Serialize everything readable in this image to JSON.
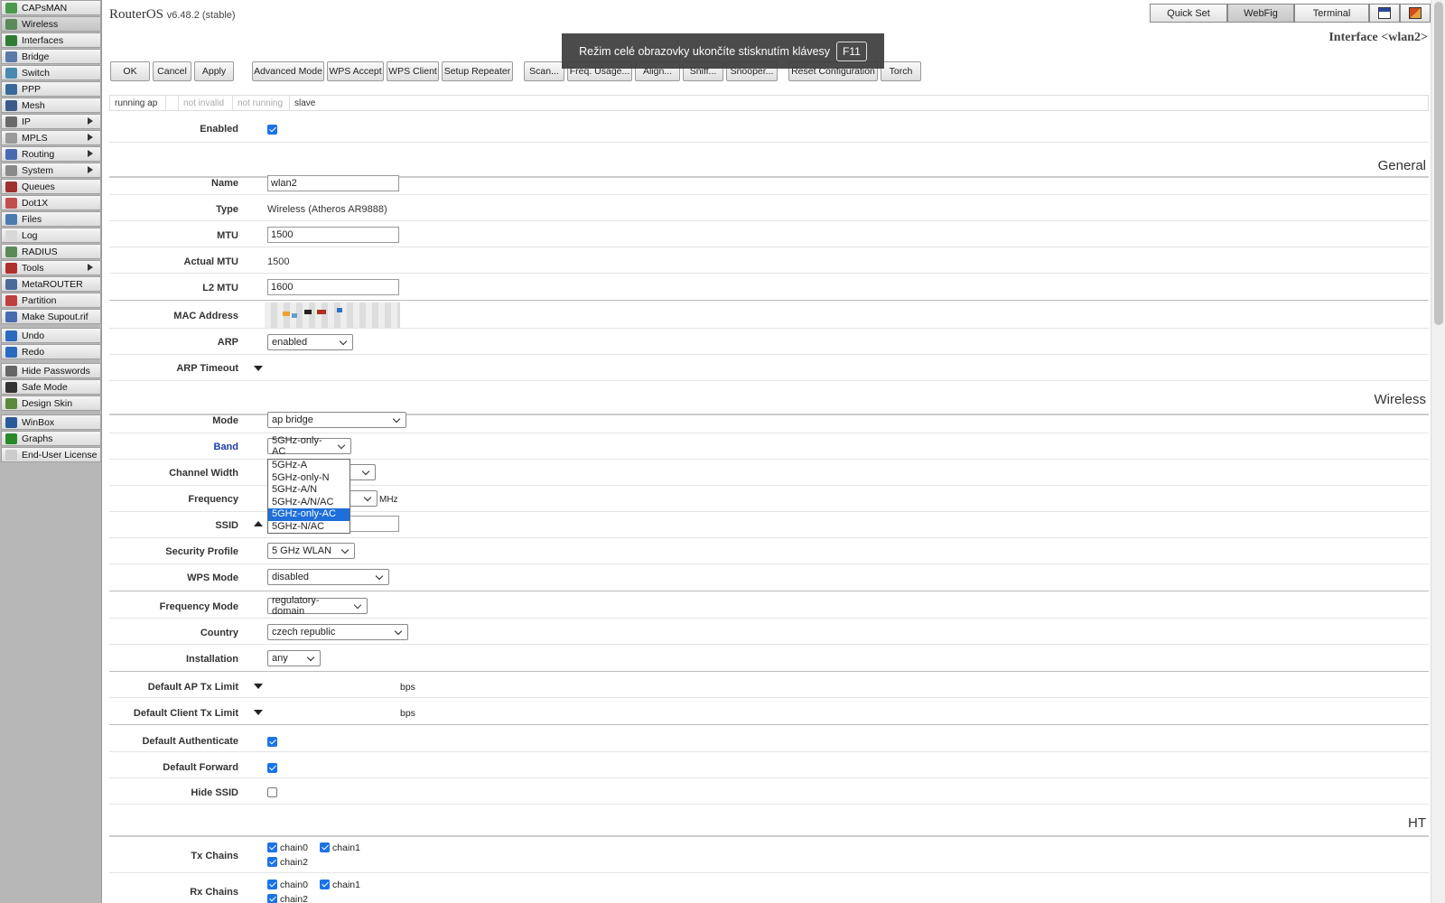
{
  "sidebar": {
    "items": [
      {
        "label": "CAPsMAN",
        "icon": "capsman-icon",
        "color": "#4a9a4a",
        "arrow": false
      },
      {
        "label": "Wireless",
        "icon": "wireless-icon",
        "color": "#5a8a5a",
        "arrow": false,
        "selected": true
      },
      {
        "label": "Interfaces",
        "icon": "interfaces-icon",
        "color": "#2e7d32",
        "arrow": false
      },
      {
        "label": "Bridge",
        "icon": "bridge-icon",
        "color": "#5a7aa8",
        "arrow": false
      },
      {
        "label": "Switch",
        "icon": "switch-icon",
        "color": "#4a8ab0",
        "arrow": false
      },
      {
        "label": "PPP",
        "icon": "ppp-icon",
        "color": "#3a6a9a",
        "arrow": false
      },
      {
        "label": "Mesh",
        "icon": "mesh-icon",
        "color": "#3a5a8a",
        "arrow": false
      },
      {
        "label": "IP",
        "icon": "ip-icon",
        "color": "#6a6a6a",
        "arrow": true
      },
      {
        "label": "MPLS",
        "icon": "mpls-icon",
        "color": "#9a9a9a",
        "arrow": true
      },
      {
        "label": "Routing",
        "icon": "routing-icon",
        "color": "#4a6ab0",
        "arrow": true
      },
      {
        "label": "System",
        "icon": "system-icon",
        "color": "#8a8a8a",
        "arrow": true
      },
      {
        "label": "Queues",
        "icon": "queues-icon",
        "color": "#a03030",
        "arrow": false
      },
      {
        "label": "Dot1X",
        "icon": "dot1x-icon",
        "color": "#c05050",
        "arrow": false
      },
      {
        "label": "Files",
        "icon": "files-icon",
        "color": "#4a7ab0",
        "arrow": false
      },
      {
        "label": "Log",
        "icon": "log-icon",
        "color": "#d8d8d8",
        "arrow": false
      },
      {
        "label": "RADIUS",
        "icon": "radius-icon",
        "color": "#5a8a5a",
        "arrow": false
      },
      {
        "label": "Tools",
        "icon": "tools-icon",
        "color": "#b03030",
        "arrow": true
      },
      {
        "label": "MetaROUTER",
        "icon": "metarouter-icon",
        "color": "#4a6a9a",
        "arrow": false
      },
      {
        "label": "Partition",
        "icon": "partition-icon",
        "color": "#c04040",
        "arrow": false
      },
      {
        "label": "Make Supout.rif",
        "icon": "supout-icon",
        "color": "#4a6ab0",
        "arrow": false
      }
    ],
    "group2": [
      {
        "label": "Undo",
        "icon": "undo-icon",
        "color": "#2a6ac0"
      },
      {
        "label": "Redo",
        "icon": "redo-icon",
        "color": "#2a6ac0"
      }
    ],
    "group3": [
      {
        "label": "Hide Passwords",
        "icon": "hide-passwords-icon",
        "color": "#666666"
      },
      {
        "label": "Safe Mode",
        "icon": "safe-mode-icon",
        "color": "#333333"
      },
      {
        "label": "Design Skin",
        "icon": "design-skin-icon",
        "color": "#5a8a3a"
      }
    ],
    "group4": [
      {
        "label": "WinBox",
        "icon": "winbox-icon",
        "color": "#2a5a9a"
      },
      {
        "label": "Graphs",
        "icon": "graphs-icon",
        "color": "#2a8a2a"
      },
      {
        "label": "End-User License",
        "icon": "license-icon",
        "color": "#cccccc"
      }
    ]
  },
  "header": {
    "product": "RouterOS",
    "version": "v6.48.2 (stable)",
    "tabs": [
      "Quick Set",
      "WebFig",
      "Terminal"
    ],
    "active_tab": "WebFig",
    "interface_title": "Interface <wlan2>"
  },
  "toast": {
    "text": "Režim celé obrazovky ukončíte stisknutím klávesy",
    "key": "F11"
  },
  "toolbar": {
    "buttons": [
      "OK",
      "Cancel",
      "Apply",
      "Advanced Mode",
      "WPS Accept",
      "WPS Client",
      "Setup Repeater",
      "Scan...",
      "Freq. Usage...",
      "Align...",
      "Sniff...",
      "Snooper...",
      "Reset Configuration",
      "Torch"
    ]
  },
  "status": [
    "running ap",
    "",
    "not invalid",
    "not running",
    "slave"
  ],
  "form": {
    "enabled_label": "Enabled",
    "general_header": "General",
    "name_label": "Name",
    "name_value": "wlan2",
    "type_label": "Type",
    "type_value": "Wireless (Atheros AR9888)",
    "mtu_label": "MTU",
    "mtu_value": "1500",
    "actual_mtu_label": "Actual MTU",
    "actual_mtu_value": "1500",
    "l2mtu_label": "L2 MTU",
    "l2mtu_value": "1600",
    "mac_label": "MAC Address",
    "arp_label": "ARP",
    "arp_value": "enabled",
    "arp_timeout_label": "ARP Timeout",
    "wireless_header": "Wireless",
    "mode_label": "Mode",
    "mode_value": "ap bridge",
    "band_label": "Band",
    "band_value": "5GHz-only-AC",
    "band_options": [
      "5GHz-A",
      "5GHz-only-N",
      "5GHz-A/N",
      "5GHz-A/N/AC",
      "5GHz-only-AC",
      "5GHz-N/AC"
    ],
    "band_selected_index": 4,
    "channel_width_label": "Channel Width",
    "frequency_label": "Frequency",
    "frequency_unit": "MHz",
    "ssid_label": "SSID",
    "security_profile_label": "Security Profile",
    "security_profile_value": "5 GHz WLAN",
    "wps_mode_label": "WPS Mode",
    "wps_mode_value": "disabled",
    "frequency_mode_label": "Frequency Mode",
    "frequency_mode_value": "regulatory-domain",
    "country_label": "Country",
    "country_value": "czech republic",
    "installation_label": "Installation",
    "installation_value": "any",
    "default_ap_tx_label": "Default AP Tx Limit",
    "default_ap_tx_unit": "bps",
    "default_client_tx_label": "Default Client Tx Limit",
    "default_client_tx_unit": "bps",
    "default_auth_label": "Default Authenticate",
    "default_forward_label": "Default Forward",
    "hide_ssid_label": "Hide SSID",
    "ht_header": "HT",
    "tx_chains_label": "Tx Chains",
    "rx_chains_label": "Rx Chains",
    "chains": [
      "chain0",
      "chain1",
      "chain2"
    ]
  }
}
